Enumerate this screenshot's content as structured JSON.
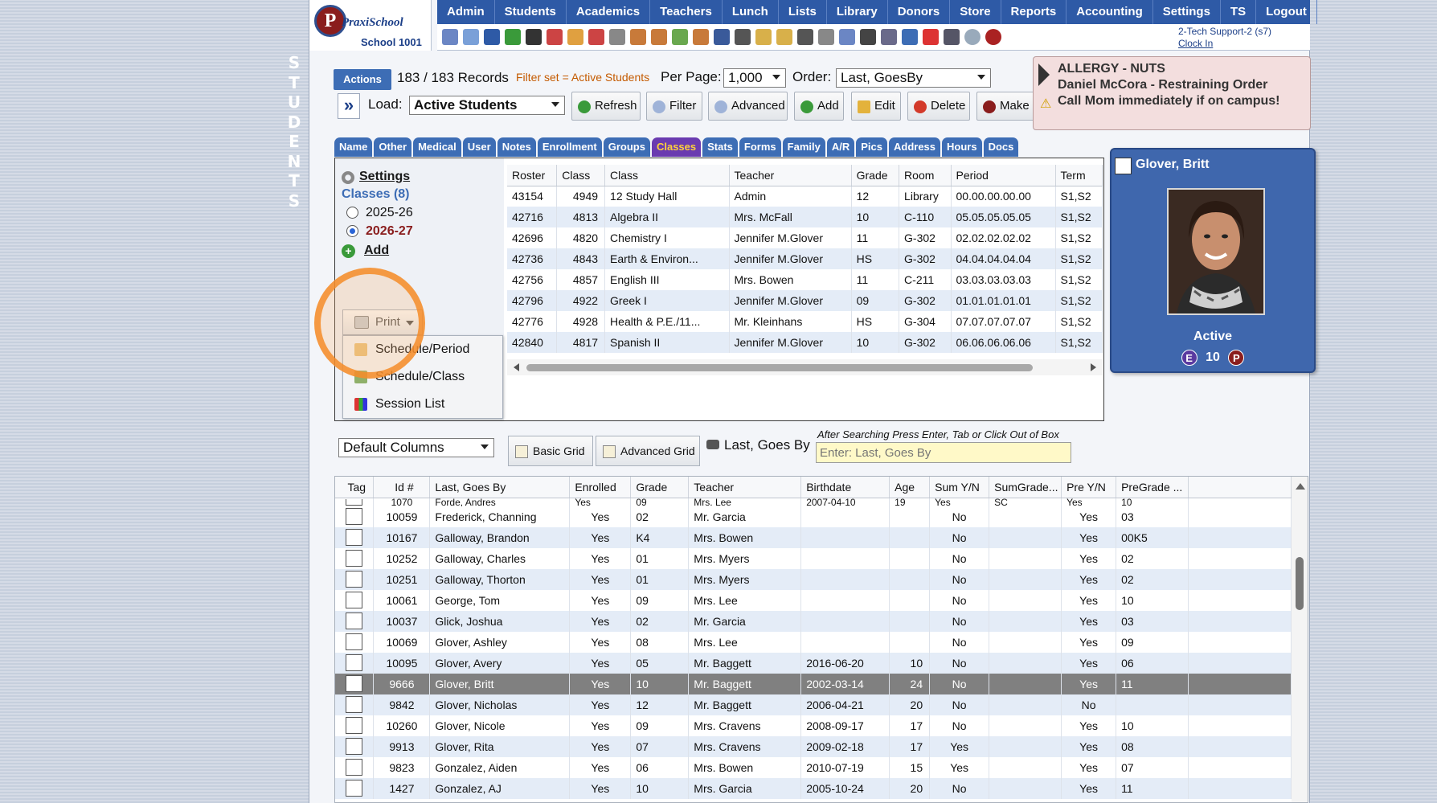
{
  "side_label": [
    "S",
    "T",
    "U",
    "D",
    "E",
    "N",
    "T",
    "S"
  ],
  "logo": {
    "brand": "PraxiSchool",
    "letter": "P",
    "school": "School 1001"
  },
  "topnav": [
    "Admin",
    "Students",
    "Academics",
    "Teachers",
    "Lunch",
    "Lists",
    "Library",
    "Donors",
    "Store",
    "Reports",
    "Accounting",
    "Settings",
    "TS",
    "Logout"
  ],
  "support": {
    "user": "2-Tech Support-2 (s7)",
    "clock": "Clock In"
  },
  "toolbar": {
    "actions": "Actions",
    "records": "183 / 183 Records",
    "filter_set": "Filter set = Active Students",
    "per_page_label": "Per Page:",
    "per_page_value": "1,000",
    "order_label": "Order:",
    "order_value": "Last, GoesBy",
    "load_label": "Load:",
    "load_value": "Active Students",
    "buttons": {
      "refresh": "Refresh",
      "filter": "Filter",
      "advanced": "Advanced",
      "add": "Add",
      "edit": "Edit",
      "delete": "Delete",
      "make": "Make"
    }
  },
  "allergy": {
    "line1": "ALLERGY - NUTS",
    "line2": "Daniel McCora - Restraining Order",
    "line3": "Call Mom immediately if on campus!"
  },
  "tabs": [
    "Name",
    "Other",
    "Medical",
    "User",
    "Notes",
    "Enrollment",
    "Groups",
    "Classes",
    "Stats",
    "Forms",
    "Family",
    "A/R",
    "Pics",
    "Address",
    "Hours",
    "Docs"
  ],
  "active_tab": "Classes",
  "classes_panel": {
    "settings": "Settings",
    "count": "Classes (8)",
    "year1": "2025-26",
    "year2": "2026-27",
    "add": "Add",
    "print": "Print",
    "print_menu": [
      "Schedule/Period",
      "Schedule/Class",
      "Session List"
    ],
    "columns": [
      "Roster",
      "Class",
      "Class",
      "Teacher",
      "Grade",
      "Room",
      "Period",
      "Term"
    ],
    "rows": [
      [
        "43154",
        "4949",
        "12 Study Hall",
        "Admin",
        "12",
        "Library",
        "00.00.00.00.00",
        "S1,S2"
      ],
      [
        "42716",
        "4813",
        "Algebra II",
        "Mrs. McFall",
        "10",
        "C-110",
        "05.05.05.05.05",
        "S1,S2"
      ],
      [
        "42696",
        "4820",
        "Chemistry I",
        "Jennifer M.Glover",
        "11",
        "G-302",
        "02.02.02.02.02",
        "S1,S2"
      ],
      [
        "42736",
        "4843",
        "Earth & Environ...",
        "Jennifer M.Glover",
        "HS",
        "G-302",
        "04.04.04.04.04",
        "S1,S2"
      ],
      [
        "42756",
        "4857",
        "English III",
        "Mrs. Bowen",
        "11",
        "C-211",
        "03.03.03.03.03",
        "S1,S2"
      ],
      [
        "42796",
        "4922",
        "Greek I",
        "Jennifer M.Glover",
        "09",
        "G-302",
        "01.01.01.01.01",
        "S1,S2"
      ],
      [
        "42776",
        "4928",
        "Health & P.E./11...",
        "Mr. Kleinhans",
        "HS",
        "G-304",
        "07.07.07.07.07",
        "S1,S2"
      ],
      [
        "42840",
        "4817",
        "Spanish II",
        "Jennifer M.Glover",
        "10",
        "G-302",
        "06.06.06.06.06",
        "S1,S2"
      ]
    ]
  },
  "student_card": {
    "name": "Glover, Britt",
    "status": "Active",
    "badge_e": "E",
    "grade": "10",
    "badge_p": "P"
  },
  "grid_controls": {
    "columns_value": "Default Columns",
    "basic_grid": "Basic Grid",
    "advanced_grid": "Advanced Grid",
    "search_label": "Last, Goes By",
    "search_hint": "After Searching Press Enter, Tab or Click Out of Box",
    "search_placeholder": "Enter: Last, Goes By"
  },
  "grid": {
    "columns": [
      "Tag",
      "Id #",
      "Last, Goes By",
      "Enrolled",
      "Grade",
      "Teacher",
      "Birthdate",
      "Age",
      "Sum Y/N",
      "SumGrade...",
      "Pre Y/N",
      "PreGrade ..."
    ],
    "partial_row": [
      "",
      "1070",
      "Forde, Andres",
      "Yes",
      "09",
      "Mrs. Lee",
      "2007-04-10",
      "19",
      "Yes",
      "SC",
      "Yes",
      "10"
    ],
    "rows": [
      [
        "10059",
        "Frederick, Channing",
        "Yes",
        "02",
        "Mr. Garcia",
        "",
        "",
        "No",
        "",
        "Yes",
        "03"
      ],
      [
        "10167",
        "Galloway, Brandon",
        "Yes",
        "K4",
        "Mrs. Bowen",
        "",
        "",
        "No",
        "",
        "Yes",
        "00K5"
      ],
      [
        "10252",
        "Galloway, Charles",
        "Yes",
        "01",
        "Mrs. Myers",
        "",
        "",
        "No",
        "",
        "Yes",
        "02"
      ],
      [
        "10251",
        "Galloway, Thorton",
        "Yes",
        "01",
        "Mrs. Myers",
        "",
        "",
        "No",
        "",
        "Yes",
        "02"
      ],
      [
        "10061",
        "George, Tom",
        "Yes",
        "09",
        "Mrs. Lee",
        "",
        "",
        "No",
        "",
        "Yes",
        "10"
      ],
      [
        "10037",
        "Glick, Joshua",
        "Yes",
        "02",
        "Mr. Garcia",
        "",
        "",
        "No",
        "",
        "Yes",
        "03"
      ],
      [
        "10069",
        "Glover, Ashley",
        "Yes",
        "08",
        "Mrs. Lee",
        "",
        "",
        "No",
        "",
        "Yes",
        "09"
      ],
      [
        "10095",
        "Glover, Avery",
        "Yes",
        "05",
        "Mr. Baggett",
        "2016-06-20",
        "10",
        "No",
        "",
        "Yes",
        "06"
      ],
      [
        "9666",
        "Glover, Britt",
        "Yes",
        "10",
        "Mr. Baggett",
        "2002-03-14",
        "24",
        "No",
        "",
        "Yes",
        "11"
      ],
      [
        "9842",
        "Glover, Nicholas",
        "Yes",
        "12",
        "Mr. Baggett",
        "2006-04-21",
        "20",
        "No",
        "",
        "No",
        ""
      ],
      [
        "10260",
        "Glover, Nicole",
        "Yes",
        "09",
        "Mrs. Cravens",
        "2008-09-17",
        "17",
        "No",
        "",
        "Yes",
        "10"
      ],
      [
        "9913",
        "Glover, Rita",
        "Yes",
        "07",
        "Mrs. Cravens",
        "2009-02-18",
        "17",
        "Yes",
        "",
        "Yes",
        "08"
      ],
      [
        "9823",
        "Gonzalez, Aiden",
        "Yes",
        "06",
        "Mrs. Bowen",
        "2010-07-19",
        "15",
        "Yes",
        "",
        "Yes",
        "07"
      ],
      [
        "1427",
        "Gonzalez, AJ",
        "Yes",
        "10",
        "Mrs. Garcia",
        "2005-10-24",
        "20",
        "No",
        "",
        "Yes",
        "11"
      ]
    ],
    "selected_id": "9666"
  },
  "colors": {
    "nav": "#2e5aa6",
    "tab": "#3d6db5",
    "active_tab": "#6a3bb0",
    "selected_row": "#808080",
    "alt_row": "#e4ecf7",
    "highlight": "#f48c28"
  }
}
